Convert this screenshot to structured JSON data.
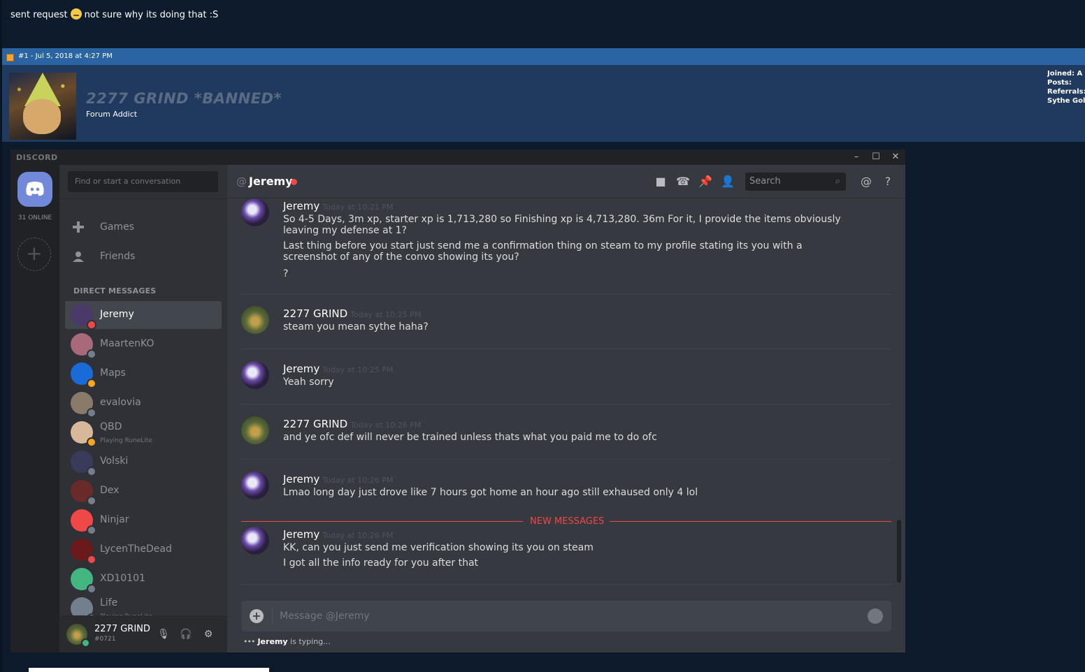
{
  "forum": {
    "top_message_before": "sent request",
    "top_message_after": "not sure why its doing that :S",
    "post_info": "#1 - Jul 5, 2018 at 4:27 PM",
    "username": "2277 GRIND *BANNED*",
    "user_title": "Forum Addict",
    "stats": [
      "Joined: A",
      "Posts:",
      "Referrals:",
      "Sythe Gol"
    ]
  },
  "discord": {
    "brand": "DISCORD",
    "window_controls": [
      "–",
      "☐",
      "✕"
    ],
    "online_count": "31 ONLINE",
    "dm_search_placeholder": "Find or start a conversation",
    "nav": [
      {
        "label": "Games",
        "icon": "gamepad-icon"
      },
      {
        "label": "Friends",
        "icon": "friends-icon"
      }
    ],
    "dm_header": "DIRECT MESSAGES",
    "dms": [
      {
        "name": "Jeremy",
        "sub": "",
        "status": "#f04747",
        "avatar": "#4a3a6a",
        "active": true
      },
      {
        "name": "MaartenKO",
        "sub": "",
        "status": "#747f8d",
        "avatar": "#a86a7a"
      },
      {
        "name": "Maps",
        "sub": "",
        "status": "#faa61a",
        "avatar": "#1a6ad8"
      },
      {
        "name": "evalovia",
        "sub": "",
        "status": "#747f8d",
        "avatar": "#8a7a6a"
      },
      {
        "name": "QBD",
        "sub": "Playing RuneLite",
        "status": "#faa61a",
        "avatar": "#d8b89a"
      },
      {
        "name": "Volski",
        "sub": "",
        "status": "#747f8d",
        "avatar": "#3a3a5a"
      },
      {
        "name": "Dex",
        "sub": "",
        "status": "#747f8d",
        "avatar": "#6a2a2a"
      },
      {
        "name": "Ninjar",
        "sub": "",
        "status": "#747f8d",
        "avatar": "#f04747"
      },
      {
        "name": "LycenTheDead",
        "sub": "",
        "status": "#f04747",
        "avatar": "#6a1a1a"
      },
      {
        "name": "XD10101",
        "sub": "",
        "status": "#747f8d",
        "avatar": "#43b581"
      },
      {
        "name": "Life",
        "sub": "Playing RuneLite",
        "status": "#43b581",
        "avatar": "#747f8d"
      }
    ],
    "user_panel": {
      "name": "2277 GRIND",
      "tag": "#0721"
    },
    "chat": {
      "recipient": "Jeremy",
      "search_placeholder": "Search",
      "messages": [
        {
          "author": "Jeremy",
          "time": "Today at 10:21 PM",
          "avatar": "eclipse",
          "lines": [
            "So 4-5 Days, 3m xp, starter xp is 1,713,280 so Finishing xp is 4,713,280. 36m For it, I provide the items obviously leaving my defense at 1?",
            "Last thing before you start just send me a confirmation thing on steam to my profile stating its you with a screenshot of any of the convo showing its you?",
            "?"
          ]
        },
        {
          "author": "2277 GRIND",
          "time": "Today at 10:25 PM",
          "avatar": "grind",
          "lines": [
            "steam you mean sythe haha?"
          ]
        },
        {
          "author": "Jeremy",
          "time": "Today at 10:25 PM",
          "avatar": "eclipse",
          "lines": [
            "Yeah sorry"
          ]
        },
        {
          "author": "2277 GRIND",
          "time": "Today at 10:26 PM",
          "avatar": "grind",
          "lines": [
            "and ye ofc def will never be trained unless thats what you paid me to do ofc"
          ]
        },
        {
          "author": "Jeremy",
          "time": "Today at 10:26 PM",
          "avatar": "eclipse",
          "lines": [
            "Lmao long day just drove like 7 hours got home an hour ago still exhaused only 4 lol"
          ]
        },
        {
          "author": "Jeremy",
          "time": "Today at 10:26 PM",
          "avatar": "eclipse",
          "lines": [
            "KK, can you just send me verification showing its you on steam",
            "I got all the info ready for you after that"
          ]
        }
      ],
      "new_messages_label": "NEW MESSAGES",
      "composer_placeholder": "Message @Jeremy",
      "typing_user": "Jeremy",
      "typing_suffix": "is typing..."
    }
  }
}
